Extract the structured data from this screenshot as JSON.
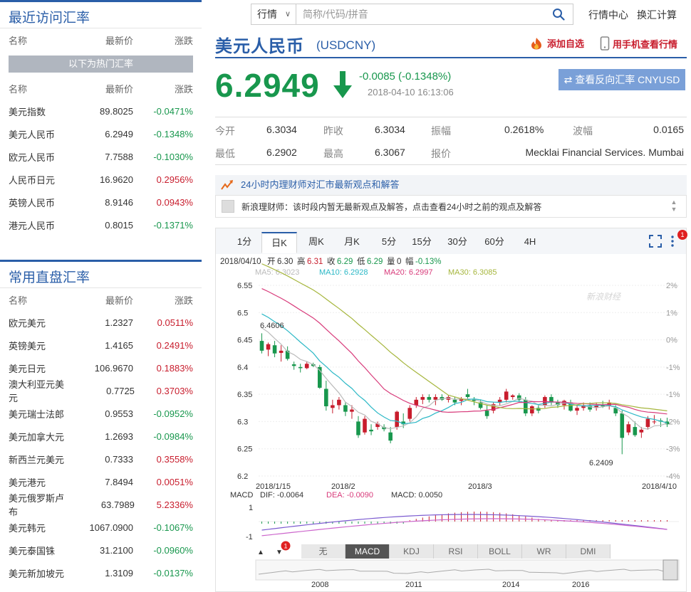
{
  "recent": {
    "title": "最近访问汇率",
    "headers": {
      "name": "名称",
      "price": "最新价",
      "chg": "涨跌"
    },
    "hot_label": "以下为热门汇率",
    "rows": [
      {
        "name": "美元指数",
        "price": "89.8025",
        "chg": "-0.0471%",
        "dir": "down"
      },
      {
        "name": "美元人民币",
        "price": "6.2949",
        "chg": "-0.1348%",
        "dir": "down"
      },
      {
        "name": "欧元人民币",
        "price": "7.7588",
        "chg": "-0.1030%",
        "dir": "down"
      },
      {
        "name": "人民币日元",
        "price": "16.9620",
        "chg": "0.2956%",
        "dir": "up"
      },
      {
        "name": "英镑人民币",
        "price": "8.9146",
        "chg": "0.0943%",
        "dir": "up"
      },
      {
        "name": "港元人民币",
        "price": "0.8015",
        "chg": "-0.1371%",
        "dir": "down"
      }
    ]
  },
  "direct": {
    "title": "常用直盘汇率",
    "headers": {
      "name": "名称",
      "price": "最新价",
      "chg": "涨跌"
    },
    "rows": [
      {
        "name": "欧元美元",
        "price": "1.2327",
        "chg": "0.0511%",
        "dir": "up"
      },
      {
        "name": "英镑美元",
        "price": "1.4165",
        "chg": "0.2491%",
        "dir": "up"
      },
      {
        "name": "美元日元",
        "price": "106.9670",
        "chg": "0.1883%",
        "dir": "up"
      },
      {
        "name": "澳大利亚元美元",
        "price": "0.7725",
        "chg": "0.3703%",
        "dir": "up"
      },
      {
        "name": "美元瑞士法郎",
        "price": "0.9553",
        "chg": "-0.0952%",
        "dir": "down"
      },
      {
        "name": "美元加拿大元",
        "price": "1.2693",
        "chg": "-0.0984%",
        "dir": "down"
      },
      {
        "name": "新西兰元美元",
        "price": "0.7333",
        "chg": "0.3558%",
        "dir": "up"
      },
      {
        "name": "美元港元",
        "price": "7.8494",
        "chg": "0.0051%",
        "dir": "up"
      },
      {
        "name": "美元俄罗斯卢布",
        "price": "63.7989",
        "chg": "5.2336%",
        "dir": "up"
      },
      {
        "name": "美元韩元",
        "price": "1067.0900",
        "chg": "-0.1067%",
        "dir": "down"
      },
      {
        "name": "美元泰国铢",
        "price": "31.2100",
        "chg": "-0.0960%",
        "dir": "down"
      },
      {
        "name": "美元新加坡元",
        "price": "1.3109",
        "chg": "-0.0137%",
        "dir": "down"
      }
    ]
  },
  "topnav": {
    "select_label": "行情",
    "search_placeholder": "简称/代码/拼音",
    "link_market": "行情中心",
    "link_convert": "换汇计算"
  },
  "header": {
    "pair_name": "美元人民币",
    "pair_code": "(USDCNY)",
    "add_fav": "添加自选",
    "mobile_view": "用手机查看行情",
    "price": "6.2949",
    "change": "-0.0085 (-0.1348%)",
    "time": "2018-04-10 16:13:06",
    "reverse_button": "⇄ 查看反向汇率 CNYUSD"
  },
  "quote": {
    "open_label": "今开",
    "open": "6.3034",
    "prev_label": "昨收",
    "prev": "6.3034",
    "amp_label": "振幅",
    "amp": "0.2618%",
    "vol_label": "波幅",
    "vol": "0.0165",
    "low_label": "最低",
    "low": "6.2902",
    "high_label": "最高",
    "high": "6.3067",
    "quoter_label": "报价",
    "quoter": "Mecklai Financial Services. Mumbai"
  },
  "advisor": {
    "head": "24小时内理财师对汇市最新观点和解答",
    "body": "新浪理财师：该时段内暂无最新观点及解答，点击查看24小时之前的观点及解答"
  },
  "chart_tabs": [
    "1分",
    "日K",
    "周K",
    "月K",
    "5分",
    "15分",
    "30分",
    "60分",
    "4H"
  ],
  "chart_tab_active": 1,
  "tool_badge": "1",
  "bottom_tabs": [
    "无",
    "MACD",
    "KDJ",
    "RSI",
    "BOLL",
    "WR",
    "DMI"
  ],
  "bottom_tab_active": 1,
  "bottom_badge": "1",
  "colors": {
    "up": "#c81d2d",
    "down": "#18974d",
    "brand": "#2a5ea8",
    "ma5": "#bbbbbb",
    "ma10": "#2bb8c6",
    "ma20": "#d83a7a",
    "ma30": "#a6b63d"
  },
  "chart_data": {
    "type": "candlestick",
    "info_line": {
      "date": "2018/04/10",
      "open_label": "开",
      "open": "6.30",
      "high_label": "高",
      "high": "6.31",
      "close_label": "收",
      "close": "6.29",
      "low_label": "低",
      "low": "6.29",
      "volume_label": "量",
      "volume": "0",
      "amp_label": "幅",
      "amp": "-0.13%"
    },
    "ma_legend": [
      {
        "name": "MA5",
        "value": "6.3023"
      },
      {
        "name": "MA10",
        "value": "6.2928"
      },
      {
        "name": "MA20",
        "value": "6.2997"
      },
      {
        "name": "MA30",
        "value": "6.3085"
      }
    ],
    "watermark": "新浪财经",
    "y_ticks": [
      "6.55",
      "6.5",
      "6.45",
      "6.4",
      "6.35",
      "6.3",
      "6.25",
      "6.2"
    ],
    "y_ticks_right": [
      "2%",
      "1%",
      "0%",
      "-1%",
      "-1%",
      "-2%",
      "-3%",
      "-4%"
    ],
    "ylim": [
      6.2,
      6.55
    ],
    "x_ticks": [
      "2018/1/15",
      "2018/2",
      "2018/3",
      "2018/4/10"
    ],
    "max_label": "6.4606",
    "min_label": "6.2409",
    "ohlc": [
      [
        6.448,
        6.462,
        6.425,
        6.43
      ],
      [
        6.432,
        6.445,
        6.42,
        6.442
      ],
      [
        6.44,
        6.448,
        6.418,
        6.425
      ],
      [
        6.426,
        6.44,
        6.41,
        6.43
      ],
      [
        6.43,
        6.438,
        6.412,
        6.415
      ],
      [
        6.405,
        6.41,
        6.395,
        6.402
      ],
      [
        6.4,
        6.406,
        6.39,
        6.398
      ],
      [
        6.398,
        6.41,
        6.396,
        6.406
      ],
      [
        6.405,
        6.408,
        6.4,
        6.402
      ],
      [
        6.4,
        6.404,
        6.36,
        6.362
      ],
      [
        6.36,
        6.375,
        6.32,
        6.328
      ],
      [
        6.325,
        6.34,
        6.315,
        6.33
      ],
      [
        6.33,
        6.345,
        6.322,
        6.34
      ],
      [
        6.33,
        6.335,
        6.31,
        6.318
      ],
      [
        6.318,
        6.33,
        6.305,
        6.322
      ],
      [
        6.3,
        6.31,
        6.27,
        6.275
      ],
      [
        6.28,
        6.31,
        6.276,
        6.305
      ],
      [
        6.285,
        6.295,
        6.275,
        6.282
      ],
      [
        6.29,
        6.3,
        6.285,
        6.296
      ],
      [
        6.29,
        6.295,
        6.282,
        6.286
      ],
      [
        6.28,
        6.29,
        6.26,
        6.265
      ],
      [
        6.29,
        6.32,
        6.285,
        6.318
      ],
      [
        6.3,
        6.315,
        6.288,
        6.295
      ],
      [
        6.305,
        6.33,
        6.3,
        6.325
      ],
      [
        6.33,
        6.345,
        6.325,
        6.34
      ],
      [
        6.34,
        6.35,
        6.332,
        6.345
      ],
      [
        6.345,
        6.35,
        6.335,
        6.34
      ],
      [
        6.34,
        6.35,
        6.33,
        6.345
      ],
      [
        6.345,
        6.35,
        6.338,
        6.34
      ],
      [
        6.34,
        6.348,
        6.335,
        6.345
      ],
      [
        6.34,
        6.345,
        6.33,
        6.335
      ],
      [
        6.338,
        6.345,
        6.33,
        6.342
      ],
      [
        6.35,
        6.36,
        6.34,
        6.345
      ],
      [
        6.34,
        6.345,
        6.33,
        6.338
      ],
      [
        6.335,
        6.34,
        6.322,
        6.325
      ],
      [
        6.32,
        6.33,
        6.305,
        6.31
      ],
      [
        6.32,
        6.335,
        6.315,
        6.332
      ],
      [
        6.335,
        6.345,
        6.33,
        6.34
      ],
      [
        6.34,
        6.36,
        6.335,
        6.355
      ],
      [
        6.345,
        6.35,
        6.34,
        6.348
      ],
      [
        6.348,
        6.352,
        6.336,
        6.34
      ],
      [
        6.34,
        6.345,
        6.31,
        6.315
      ],
      [
        6.315,
        6.33,
        6.31,
        6.328
      ],
      [
        6.325,
        6.33,
        6.315,
        6.32
      ],
      [
        6.33,
        6.348,
        6.325,
        6.345
      ],
      [
        6.345,
        6.35,
        6.33,
        6.335
      ],
      [
        6.335,
        6.34,
        6.325,
        6.33
      ],
      [
        6.33,
        6.34,
        6.322,
        6.338
      ],
      [
        6.335,
        6.34,
        6.318,
        6.32
      ],
      [
        6.32,
        6.33,
        6.312,
        6.325
      ],
      [
        6.325,
        6.335,
        6.32,
        6.33
      ],
      [
        6.33,
        6.335,
        6.318,
        6.322
      ],
      [
        6.325,
        6.335,
        6.32,
        6.33
      ],
      [
        6.33,
        6.338,
        6.325,
        6.328
      ],
      [
        6.33,
        6.34,
        6.322,
        6.335
      ],
      [
        6.325,
        6.33,
        6.31,
        6.315
      ],
      [
        6.315,
        6.32,
        6.24,
        6.27
      ],
      [
        6.28,
        6.3,
        6.275,
        6.295
      ],
      [
        6.29,
        6.3,
        6.272,
        6.275
      ],
      [
        6.28,
        6.29,
        6.27,
        6.285
      ],
      [
        6.29,
        6.31,
        6.285,
        6.305
      ],
      [
        6.3,
        6.312,
        6.295,
        6.3
      ],
      [
        6.302,
        6.306,
        6.29,
        6.3
      ],
      [
        6.3,
        6.307,
        6.29,
        6.2949
      ]
    ],
    "macd_legend": {
      "name": "MACD",
      "dif_label": "DIF",
      "dif": "-0.0064",
      "dea_label": "DEA",
      "dea": "-0.0090",
      "macd_label": "MACD",
      "macd": "0.0050"
    },
    "macd_ticks": [
      "1",
      "-1"
    ],
    "overview_years": [
      "2008",
      "2011",
      "2014",
      "2016"
    ]
  }
}
